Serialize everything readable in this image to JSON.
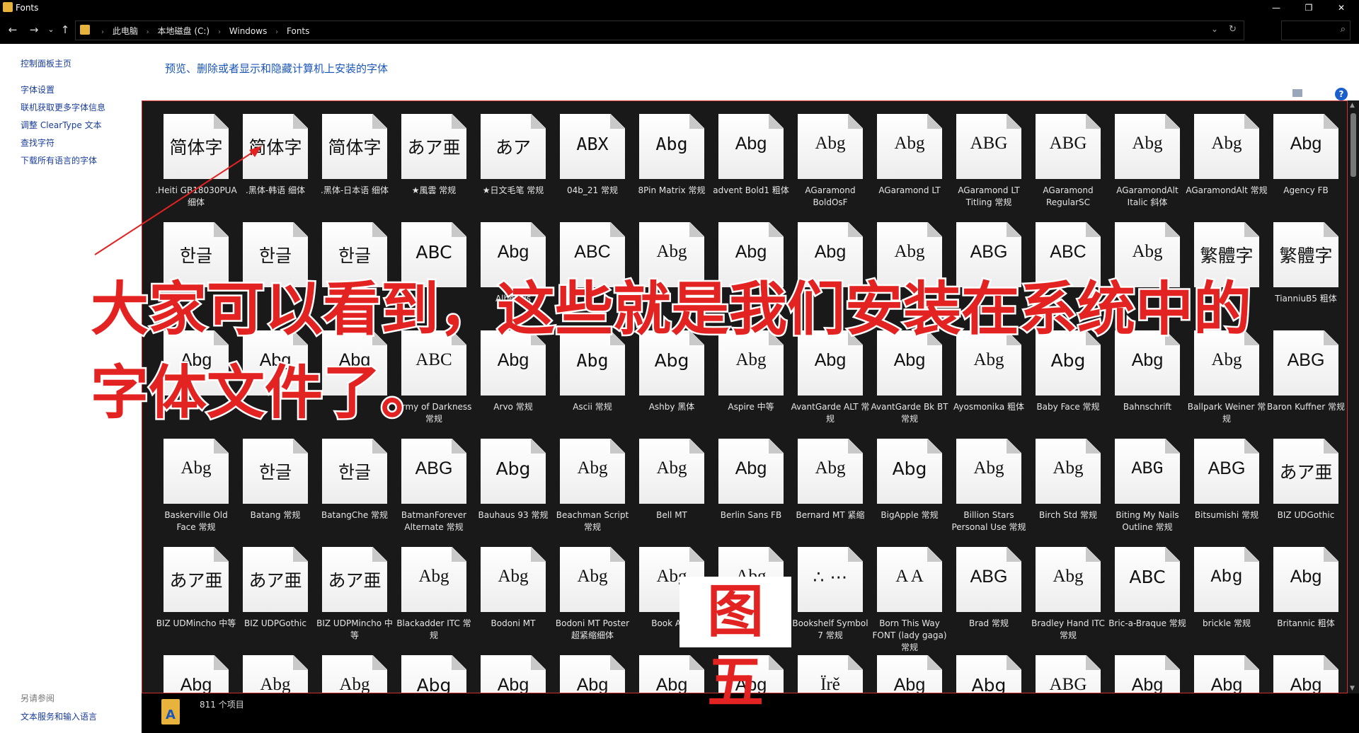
{
  "window": {
    "title": "Fonts",
    "minimize": "—",
    "maximize": "❐",
    "close": "✕"
  },
  "nav": {
    "back": "←",
    "forward": "→",
    "recent": "⌄",
    "up": "↑"
  },
  "address": {
    "crumbs": [
      "此电脑",
      "本地磁盘 (C:)",
      "Windows",
      "Fonts"
    ],
    "dropdown": "⌄",
    "refresh": "↻"
  },
  "search": {
    "placeholder": "",
    "icon": "⌕"
  },
  "sidebar": {
    "home": "控制面板主页",
    "links": [
      "字体设置",
      "联机获取更多字体信息",
      "调整 ClearType 文本",
      "查找字符",
      "下载所有语言的字体"
    ],
    "see_also_title": "另请参阅",
    "see_also_links": [
      "文本服务和输入语言"
    ]
  },
  "heading": "预览、删除或者显示和隐藏计算机上安装的字体",
  "help": "?",
  "status": {
    "count": "811 个项目",
    "folder_icon": "A"
  },
  "overlay": {
    "line1": "大家可以看到，这些就是我们安装在系统中的",
    "line2": "字体文件了。",
    "figure_label": "图五"
  },
  "fonts": [
    [
      {
        "sample": "简体字",
        "label": ".Heiti GB18030PUA 细体",
        "ff": "\"DejaVu Sans\", sans-serif",
        "stack": false
      },
      {
        "sample": "简体字",
        "label": ".黑体-韩语 细体",
        "ff": "\"DejaVu Sans\", sans-serif",
        "stack": false
      },
      {
        "sample": "简体字",
        "label": ".黑体-日本语 细体",
        "ff": "\"DejaVu Sans\", sans-serif",
        "stack": false
      },
      {
        "sample": "あア亜",
        "label": "★風雲 常规",
        "ff": "\"DejaVu Sans\", sans-serif",
        "stack": false
      },
      {
        "sample": "あア",
        "label": "★日文毛笔 常规",
        "ff": "\"DejaVu Serif\", serif",
        "stack": false
      },
      {
        "sample": "ABX",
        "label": "04b_21 常规",
        "ff": "\"DejaVu Sans Mono\", monospace",
        "stack": false
      },
      {
        "sample": "Abg",
        "label": "8Pin Matrix 常规",
        "ff": "\"DejaVu Sans Mono\", monospace",
        "stack": false
      },
      {
        "sample": "Abg",
        "label": "advent Bold1 粗体",
        "ff": "\"Liberation Sans\", sans-serif",
        "stack": false
      },
      {
        "sample": "Abg",
        "label": "AGaramond BoldOsF",
        "ff": "\"Liberation Serif\", serif",
        "stack": false
      },
      {
        "sample": "Abg",
        "label": "AGaramond LT",
        "ff": "\"Liberation Serif\", serif",
        "stack": true
      },
      {
        "sample": "ABG",
        "label": "AGaramond LT Titling 常规",
        "ff": "\"Liberation Serif\", serif",
        "stack": false
      },
      {
        "sample": "ABG",
        "label": "AGaramond RegularSC",
        "ff": "\"Liberation Serif\", serif",
        "stack": false
      },
      {
        "sample": "Abg",
        "label": "AGaramondAlt Italic 斜体",
        "ff": "\"Liberation Serif\", serif",
        "stack": false
      },
      {
        "sample": "Abg",
        "label": "AGaramondAlt 常规",
        "ff": "\"Liberation Serif\", serif",
        "stack": false
      },
      {
        "sample": "Abg",
        "label": "Agency FB",
        "ff": "\"Liberation Sans\", sans-serif",
        "stack": true
      }
    ],
    [
      {
        "sample": "한글",
        "label": "",
        "ff": "\"DejaVu Sans\", sans-serif",
        "stack": false
      },
      {
        "sample": "한글",
        "label": "",
        "ff": "\"DejaVu Sans\", sans-serif",
        "stack": false
      },
      {
        "sample": "한글",
        "label": "",
        "ff": "\"DejaVu Sans\", sans-serif",
        "stack": false
      },
      {
        "sample": "ABC",
        "label": "",
        "ff": "\"DejaVu Sans\", sans-serif",
        "stack": false
      },
      {
        "sample": "Abg",
        "label": "Albertus",
        "ff": "\"Liberation Sans\", sans-serif",
        "stack": false
      },
      {
        "sample": "ABC",
        "label": "",
        "ff": "\"Liberation Sans\", sans-serif",
        "stack": false
      },
      {
        "sample": "Abg",
        "label": "",
        "ff": "\"Liberation Serif\", serif",
        "stack": false
      },
      {
        "sample": "Abg",
        "label": "",
        "ff": "\"Liberation Sans\", sans-serif",
        "stack": false
      },
      {
        "sample": "Abg",
        "label": "",
        "ff": "\"Liberation Sans\", sans-serif",
        "stack": false
      },
      {
        "sample": "Abg",
        "label": "",
        "ff": "\"Liberation Serif\", serif",
        "stack": false
      },
      {
        "sample": "ABG",
        "label": "",
        "ff": "\"Liberation Sans\", sans-serif",
        "stack": false
      },
      {
        "sample": "ABC",
        "label": "",
        "ff": "\"Liberation Sans\", sans-serif",
        "stack": false
      },
      {
        "sample": "Abg",
        "label": "",
        "ff": "\"Liberation Serif\", serif",
        "stack": false
      },
      {
        "sample": "繁體字",
        "label": "",
        "ff": "\"DejaVu Sans\", sans-serif",
        "stack": false
      },
      {
        "sample": "繁體字",
        "label": "TianniuB5 粗体",
        "ff": "\"DejaVu Sans\", sans-serif",
        "stack": false
      }
    ],
    [
      {
        "sample": "Abg",
        "label": "",
        "ff": "\"Liberation Sans\", sans-serif",
        "stack": false
      },
      {
        "sample": "Abg",
        "label": "",
        "ff": "\"Liberation Sans\", sans-serif",
        "stack": false
      },
      {
        "sample": "Abg",
        "label": "",
        "ff": "\"Liberation Sans\", sans-serif",
        "stack": false
      },
      {
        "sample": "ABC",
        "label": "Army of Darkness 常规",
        "ff": "\"Liberation Serif\", serif",
        "stack": false
      },
      {
        "sample": "Abg",
        "label": "Arvo 常规",
        "ff": "\"Liberation Sans\", sans-serif",
        "stack": false
      },
      {
        "sample": "Abg",
        "label": "Ascii 常规",
        "ff": "\"DejaVu Sans Mono\", monospace",
        "stack": false
      },
      {
        "sample": "Abg",
        "label": "Ashby 黑体",
        "ff": "\"DejaVu Sans\", sans-serif",
        "stack": false
      },
      {
        "sample": "Abg",
        "label": "Aspire 中等",
        "ff": "\"Liberation Serif\", serif",
        "stack": false
      },
      {
        "sample": "Abg",
        "label": "AvantGarde ALT 常规",
        "ff": "\"Liberation Sans\", sans-serif",
        "stack": false
      },
      {
        "sample": "Abg",
        "label": "AvantGarde Bk BT 常规",
        "ff": "\"Liberation Sans\", sans-serif",
        "stack": false
      },
      {
        "sample": "Abg",
        "label": "Ayosmonika 粗体",
        "ff": "\"Liberation Serif\", serif",
        "stack": false
      },
      {
        "sample": "Abg",
        "label": "Baby Face 常规",
        "ff": "\"DejaVu Sans\", sans-serif",
        "stack": false
      },
      {
        "sample": "Abg",
        "label": "Bahnschrift",
        "ff": "\"Liberation Sans\", sans-serif",
        "stack": true
      },
      {
        "sample": "Abg",
        "label": "Ballpark Weiner 常规",
        "ff": "\"Liberation Serif\", serif",
        "stack": false
      },
      {
        "sample": "ABG",
        "label": "Baron Kuffner 常规",
        "ff": "\"Liberation Sans\", sans-serif",
        "stack": false
      }
    ],
    [
      {
        "sample": "Abg",
        "label": "Baskerville Old Face 常规",
        "ff": "\"Liberation Serif\", serif",
        "stack": false
      },
      {
        "sample": "한글",
        "label": "Batang 常规",
        "ff": "\"DejaVu Serif\", serif",
        "stack": false
      },
      {
        "sample": "한글",
        "label": "BatangChe 常规",
        "ff": "\"DejaVu Serif\", serif",
        "stack": false
      },
      {
        "sample": "ABG",
        "label": "BatmanForever Alternate 常规",
        "ff": "\"Liberation Sans\", sans-serif",
        "stack": false
      },
      {
        "sample": "Abg",
        "label": "Bauhaus 93 常规",
        "ff": "\"DejaVu Sans\", sans-serif",
        "stack": false
      },
      {
        "sample": "Abg",
        "label": "Beachman Script 常规",
        "ff": "\"Liberation Serif\", serif",
        "stack": false
      },
      {
        "sample": "Abg",
        "label": "Bell MT",
        "ff": "\"Liberation Serif\", serif",
        "stack": true
      },
      {
        "sample": "Abg",
        "label": "Berlin Sans FB",
        "ff": "\"Liberation Sans\", sans-serif",
        "stack": true
      },
      {
        "sample": "Abg",
        "label": "Bernard MT 紧缩",
        "ff": "\"Liberation Serif\", serif",
        "stack": false
      },
      {
        "sample": "Abg",
        "label": "BigApple 常规",
        "ff": "\"DejaVu Sans\", sans-serif",
        "stack": false
      },
      {
        "sample": "Abg",
        "label": "Billion Stars Personal Use 常规",
        "ff": "\"Liberation Serif\", serif",
        "stack": false
      },
      {
        "sample": "Abg",
        "label": "Birch Std 常规",
        "ff": "\"Liberation Serif\", serif",
        "stack": false
      },
      {
        "sample": "ABG",
        "label": "Biting My Nails Outline 常规",
        "ff": "\"Liberation Mono\", monospace",
        "stack": false
      },
      {
        "sample": "ABG",
        "label": "Bitsumishi 常规",
        "ff": "\"Liberation Sans\", sans-serif",
        "stack": false
      },
      {
        "sample": "あア亜",
        "label": "BIZ UDGothic",
        "ff": "\"DejaVu Sans\", sans-serif",
        "stack": true
      }
    ],
    [
      {
        "sample": "あア亜",
        "label": "BIZ UDMincho 中等",
        "ff": "\"DejaVu Serif\", serif",
        "stack": false
      },
      {
        "sample": "あア亜",
        "label": "BIZ UDPGothic",
        "ff": "\"DejaVu Sans\", sans-serif",
        "stack": true
      },
      {
        "sample": "あア亜",
        "label": "BIZ UDPMincho 中等",
        "ff": "\"DejaVu Serif\", serif",
        "stack": false
      },
      {
        "sample": "Abg",
        "label": "Blackadder ITC 常规",
        "ff": "\"Liberation Serif\", serif",
        "stack": false
      },
      {
        "sample": "Abg",
        "label": "Bodoni MT",
        "ff": "\"Liberation Serif\", serif",
        "stack": true
      },
      {
        "sample": "Abg",
        "label": "Bodoni MT Poster 超紧缩细体",
        "ff": "\"Liberation Serif\", serif",
        "stack": false
      },
      {
        "sample": "Abg",
        "label": "Book Anti",
        "ff": "\"Liberation Serif\", serif",
        "stack": true
      },
      {
        "sample": "Abg",
        "label": "",
        "ff": "\"Liberation Serif\", serif",
        "stack": true
      },
      {
        "sample": "∴ ⋯",
        "label": "Bookshelf Symbol 7 常规",
        "ff": "\"DejaVu Sans\", sans-serif",
        "stack": false
      },
      {
        "sample": "A A",
        "label": "Born This Way FONT (lady gaga) 常规",
        "ff": "\"Liberation Serif\", serif",
        "stack": false
      },
      {
        "sample": "ABG",
        "label": "Brad 常规",
        "ff": "\"Liberation Sans\", sans-serif",
        "stack": false
      },
      {
        "sample": "Abg",
        "label": "Bradley Hand ITC 常规",
        "ff": "\"Liberation Serif\", serif",
        "stack": false
      },
      {
        "sample": "ABC",
        "label": "Bric-a-Braque 常规",
        "ff": "\"DejaVu Sans\", sans-serif",
        "stack": false
      },
      {
        "sample": "Abg",
        "label": "brickle 常规",
        "ff": "\"Liberation Mono\", monospace",
        "stack": false
      },
      {
        "sample": "Abg",
        "label": "Britannic 粗体",
        "ff": "\"Liberation Sans\", sans-serif",
        "stack": false
      }
    ],
    [
      {
        "sample": "Abg",
        "label": "",
        "ff": "\"Liberation Sans\", sans-serif",
        "stack": false
      },
      {
        "sample": "Abg",
        "label": "",
        "ff": "\"Liberation Serif\", serif",
        "stack": false
      },
      {
        "sample": "Abg",
        "label": "",
        "ff": "\"Liberation Serif\", serif",
        "stack": false
      },
      {
        "sample": "Abg",
        "label": "",
        "ff": "\"DejaVu Sans\", sans-serif",
        "stack": false
      },
      {
        "sample": "Abg",
        "label": "",
        "ff": "\"Liberation Sans\", sans-serif",
        "stack": false
      },
      {
        "sample": "Abg",
        "label": "",
        "ff": "\"Liberation Sans\", sans-serif",
        "stack": true
      },
      {
        "sample": "Abg",
        "label": "",
        "ff": "\"Liberation Sans\", sans-serif",
        "stack": true
      },
      {
        "sample": "Abg",
        "label": "",
        "ff": "\"Liberation Sans\", sans-serif",
        "stack": true
      },
      {
        "sample": "Ïrě",
        "label": "",
        "ff": "\"Liberation Serif\", serif",
        "stack": false
      },
      {
        "sample": "Abg",
        "label": "",
        "ff": "\"Liberation Sans\", sans-serif",
        "stack": true
      },
      {
        "sample": "Abg",
        "label": "",
        "ff": "\"DejaVu Sans\", sans-serif",
        "stack": false
      },
      {
        "sample": "ABG",
        "label": "",
        "ff": "\"Liberation Serif\", serif",
        "stack": false
      },
      {
        "sample": "Abg",
        "label": "",
        "ff": "\"Liberation Sans\", sans-serif",
        "stack": true
      },
      {
        "sample": "Abg",
        "label": "",
        "ff": "\"Liberation Sans\", sans-serif",
        "stack": true
      },
      {
        "sample": "Abg",
        "label": "",
        "ff": "\"Liberation Sans\", sans-serif",
        "stack": true
      }
    ]
  ]
}
